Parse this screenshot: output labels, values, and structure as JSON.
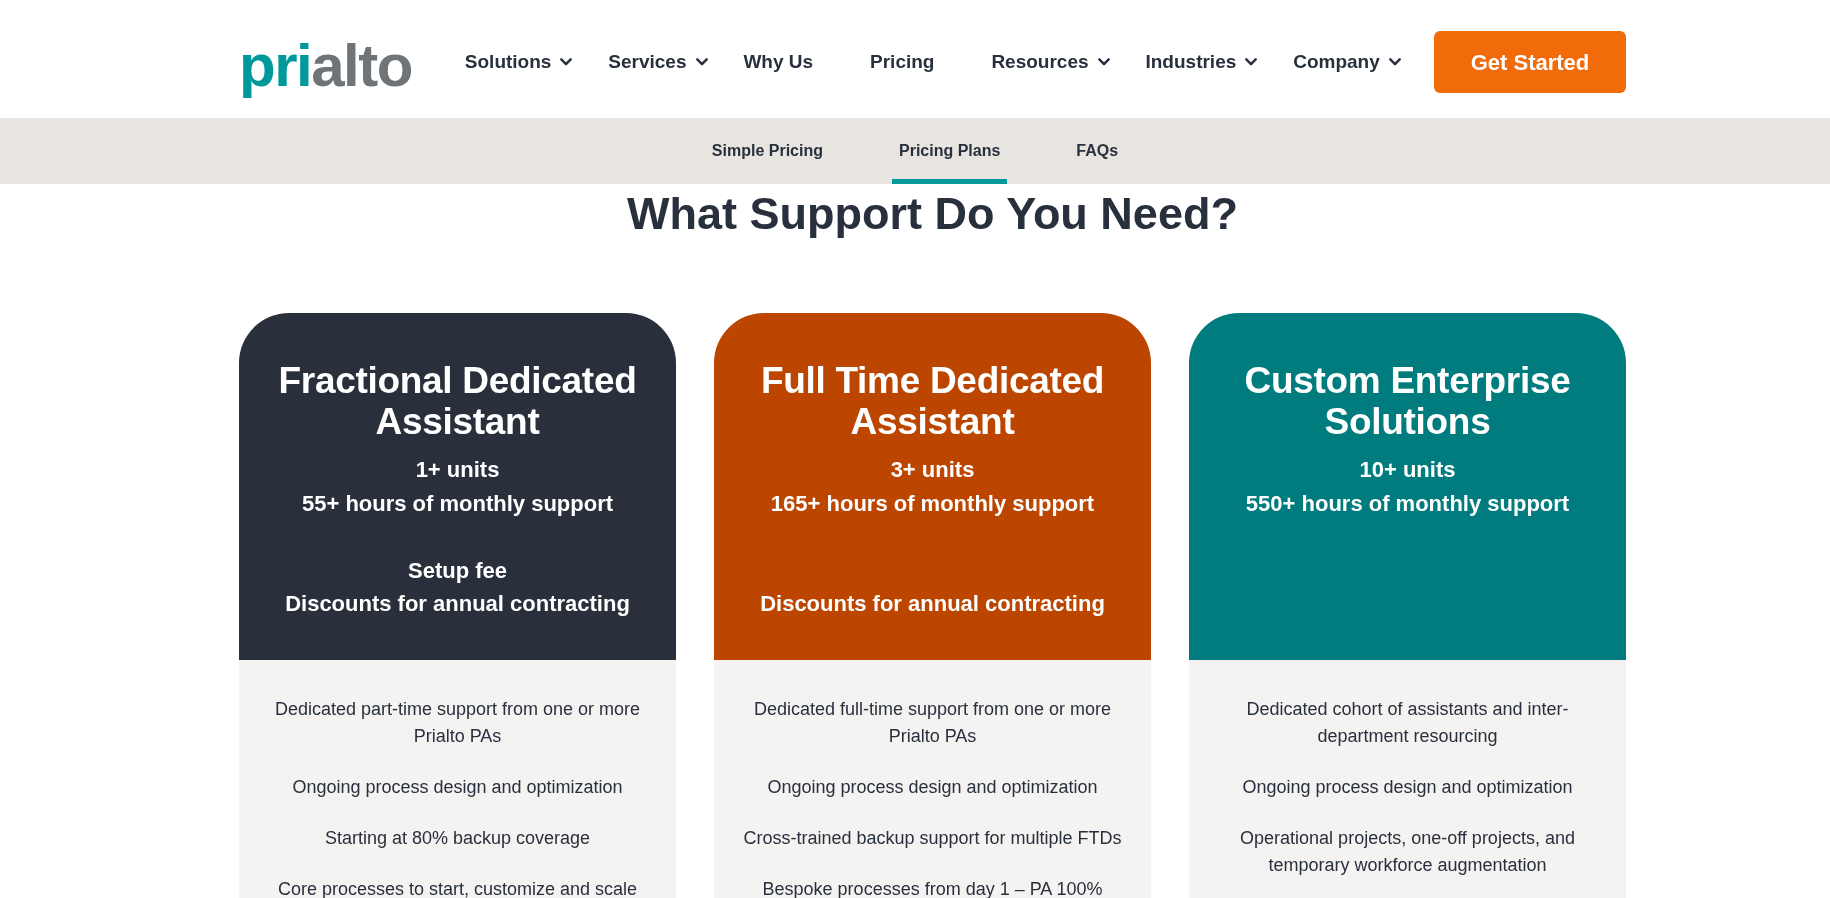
{
  "header": {
    "logo": {
      "parts": [
        {
          "text": "pri",
          "color": "#00999b"
        },
        {
          "text": "alto",
          "color": "#6f7479"
        }
      ]
    },
    "nav": [
      {
        "label": "Solutions",
        "has_menu": true
      },
      {
        "label": "Services",
        "has_menu": true
      },
      {
        "label": "Why Us",
        "has_menu": false
      },
      {
        "label": "Pricing",
        "has_menu": false
      },
      {
        "label": "Resources",
        "has_menu": true
      },
      {
        "label": "Industries",
        "has_menu": true
      },
      {
        "label": "Company",
        "has_menu": true
      }
    ],
    "cta_button": "Get Started"
  },
  "subnav": {
    "tabs": [
      {
        "label": "Simple Pricing",
        "selected": false
      },
      {
        "label": "Pricing Plans",
        "selected": true
      },
      {
        "label": "FAQs",
        "selected": false
      }
    ]
  },
  "heading": "What Support Do You Need?",
  "plans": [
    {
      "title": "Fractional Dedicated Assistant",
      "color": "#29303c",
      "units": "1+ units",
      "hours": "55+ hours of monthly support",
      "notes": [
        "Setup fee",
        "Discounts for annual contracting"
      ],
      "features": [
        "Dedicated part-time support from one or more Prialto PAs",
        "Ongoing process design and optimization",
        "Starting at 80% backup coverage",
        "Core processes to start, customize and scale"
      ]
    },
    {
      "title": "Full Time Dedicated Assistant",
      "color": "#bc4500",
      "units": "3+ units",
      "hours": "165+ hours of monthly support",
      "notes": [
        "Discounts for annual contracting"
      ],
      "features": [
        "Dedicated full-time support from one or more Prialto PAs",
        "Ongoing process design and optimization",
        "Cross-trained backup support for multiple FTDs",
        "Bespoke processes from day 1 – PA 100%"
      ]
    },
    {
      "title": "Custom Enterprise Solutions",
      "color": "#007b7e",
      "units": "10+ units",
      "hours": "550+ hours of monthly support",
      "features": [
        "Dedicated cohort of assistants and inter-department resourcing",
        "Ongoing process design and optimization",
        "Operational projects, one-off projects, and temporary workforce augmentation"
      ]
    }
  ]
}
